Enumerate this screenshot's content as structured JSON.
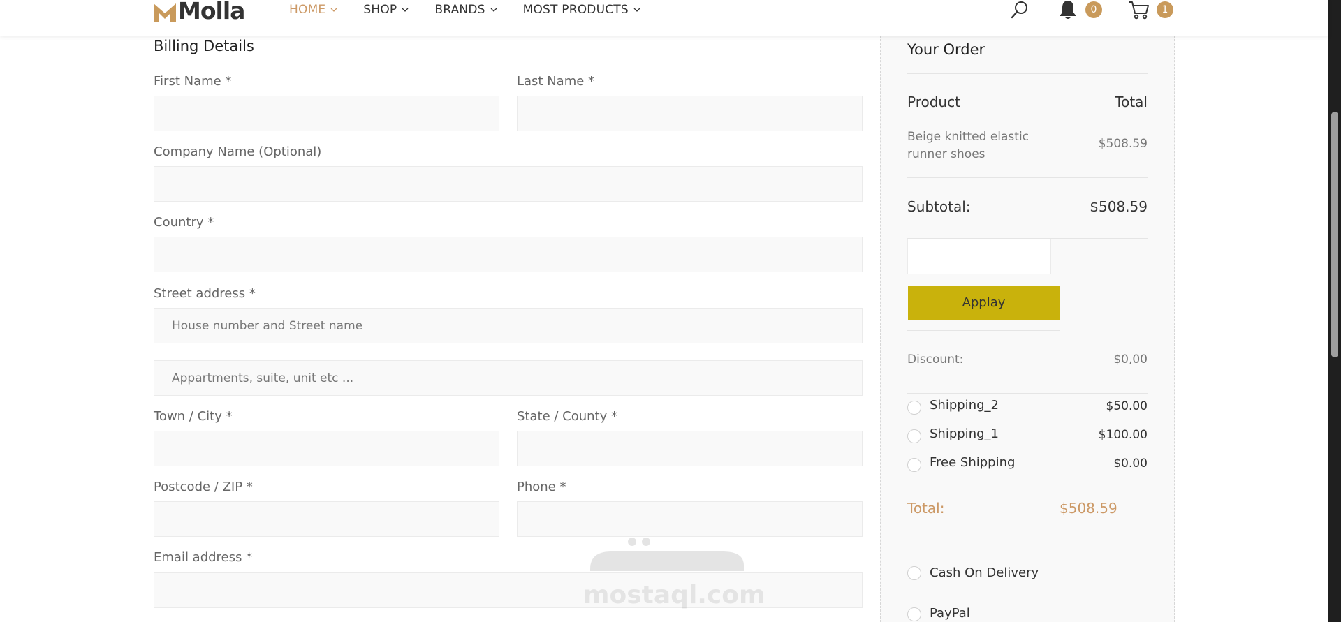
{
  "header": {
    "logo_text": "Molla",
    "nav": [
      {
        "label": "HOME"
      },
      {
        "label": "SHOP"
      },
      {
        "label": "BRANDS"
      },
      {
        "label": "MOST PRODUCTS"
      }
    ],
    "notification_count": "0",
    "cart_count": "1",
    "icons": [
      "search-icon",
      "bell-icon",
      "cart-icon",
      "chevron-down-icon"
    ]
  },
  "billing": {
    "title": "Billing Details",
    "first_name_label": "First Name *",
    "last_name_label": "Last Name *",
    "company_label": "Company Name (Optional)",
    "country_label": "Country *",
    "street_label": "Street address *",
    "street_placeholder": "House number and Street name",
    "apt_placeholder": "Appartments, suite, unit etc ...",
    "city_label": "Town / City *",
    "state_label": "State / County *",
    "postcode_label": "Postcode / ZIP *",
    "phone_label": "Phone *",
    "email_label": "Email address *"
  },
  "order": {
    "title": "Your Order",
    "product_header": "Product",
    "total_header": "Total",
    "product_name": "Beige knitted elastic runner shoes",
    "product_price": "$508.59",
    "subtotal_label": "Subtotal:",
    "subtotal_value": "$508.59",
    "apply_label": "Applay",
    "discount_label": "Discount:",
    "discount_value": "$0,00",
    "shipping": [
      {
        "label": "Shipping_2",
        "price": "$50.00"
      },
      {
        "label": "Shipping_1",
        "price": "$100.00"
      },
      {
        "label": "Free Shipping",
        "price": "$0.00"
      }
    ],
    "total_label": "Total:",
    "total_value": "$508.59",
    "payment": [
      {
        "label": "Cash On Delivery"
      },
      {
        "label": "PayPal"
      }
    ]
  },
  "watermark": {
    "text": "mostaql.com"
  },
  "colors": {
    "accent": "#cc9966",
    "apply_button": "#c9b20c",
    "badge": "#c99a5b",
    "input_bg": "#f9f9f9"
  }
}
